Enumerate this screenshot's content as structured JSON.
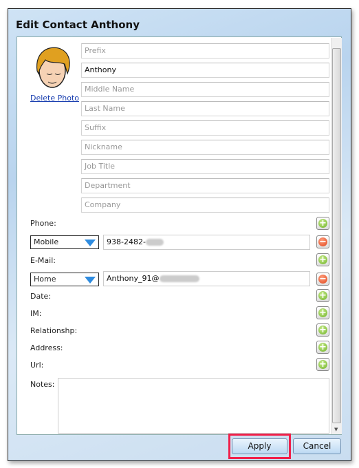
{
  "window": {
    "title": "Edit Contact Anthony"
  },
  "photo": {
    "delete_label": "Delete Photo"
  },
  "name_fields": [
    {
      "placeholder": "Prefix",
      "value": ""
    },
    {
      "placeholder": "First Name",
      "value": "Anthony"
    },
    {
      "placeholder": "Middle Name",
      "value": ""
    },
    {
      "placeholder": "Last Name",
      "value": ""
    },
    {
      "placeholder": "Suffix",
      "value": ""
    },
    {
      "placeholder": "Nickname",
      "value": ""
    },
    {
      "placeholder": "Job Title",
      "value": ""
    },
    {
      "placeholder": "Department",
      "value": ""
    },
    {
      "placeholder": "Company",
      "value": ""
    }
  ],
  "phone": {
    "label": "Phone:",
    "type": "Mobile",
    "value": "938-2482-"
  },
  "email": {
    "label": "E-Mail:",
    "type": "Home",
    "value": "Anthony_91@"
  },
  "sections": [
    "Date:",
    "IM:",
    "Relationshp:",
    "Address:",
    "Url:"
  ],
  "notes": {
    "label": "Notes:",
    "value": ""
  },
  "buttons": {
    "apply": "Apply",
    "cancel": "Cancel"
  },
  "icons": {
    "add": "plus-circle-icon",
    "remove": "minus-circle-icon",
    "dropdown": "triangle-down-icon"
  },
  "colors": {
    "highlight": "#f0204a",
    "add": "#6fb229",
    "remove": "#e0441a"
  }
}
